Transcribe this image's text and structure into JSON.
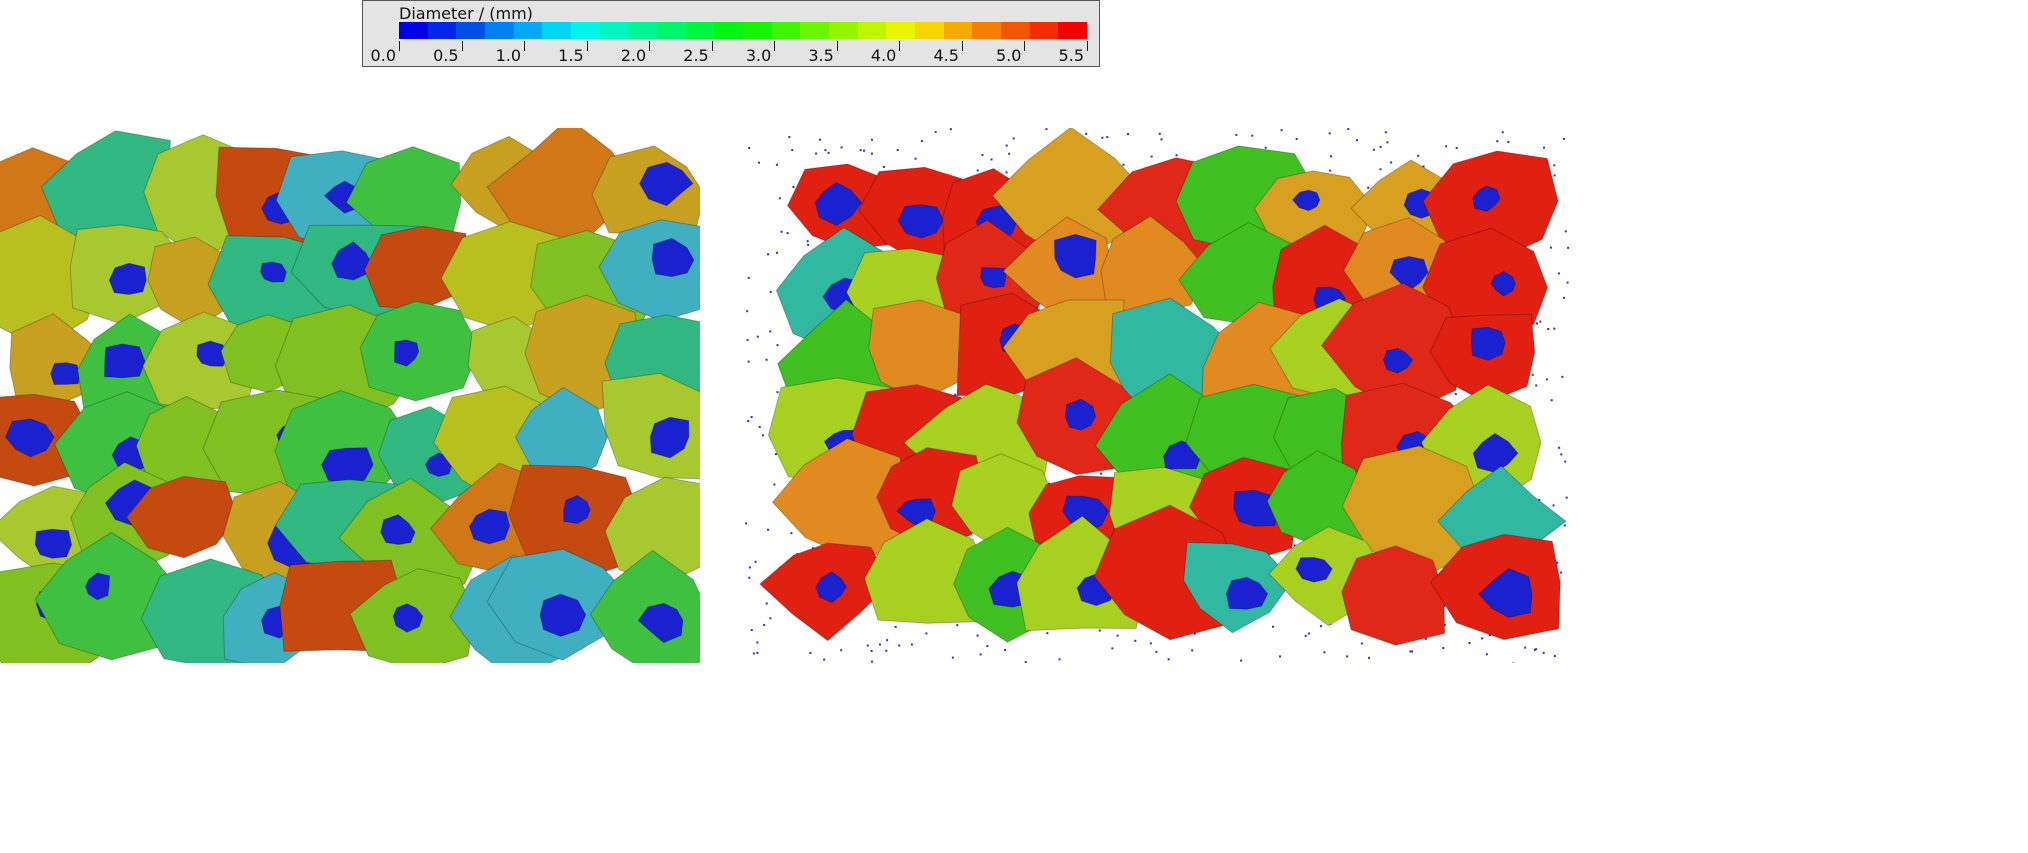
{
  "legend": {
    "title": "Diameter / (mm)",
    "ticks": [
      "0.0",
      "0.5",
      "1.0",
      "1.5",
      "2.0",
      "2.5",
      "3.0",
      "3.5",
      "4.0",
      "4.5",
      "5.0",
      "5.5"
    ],
    "range": [
      0,
      5.5
    ],
    "steps": 24
  },
  "panels": [
    {
      "name": "left-rendering"
    },
    {
      "name": "right-rendering"
    }
  ]
}
